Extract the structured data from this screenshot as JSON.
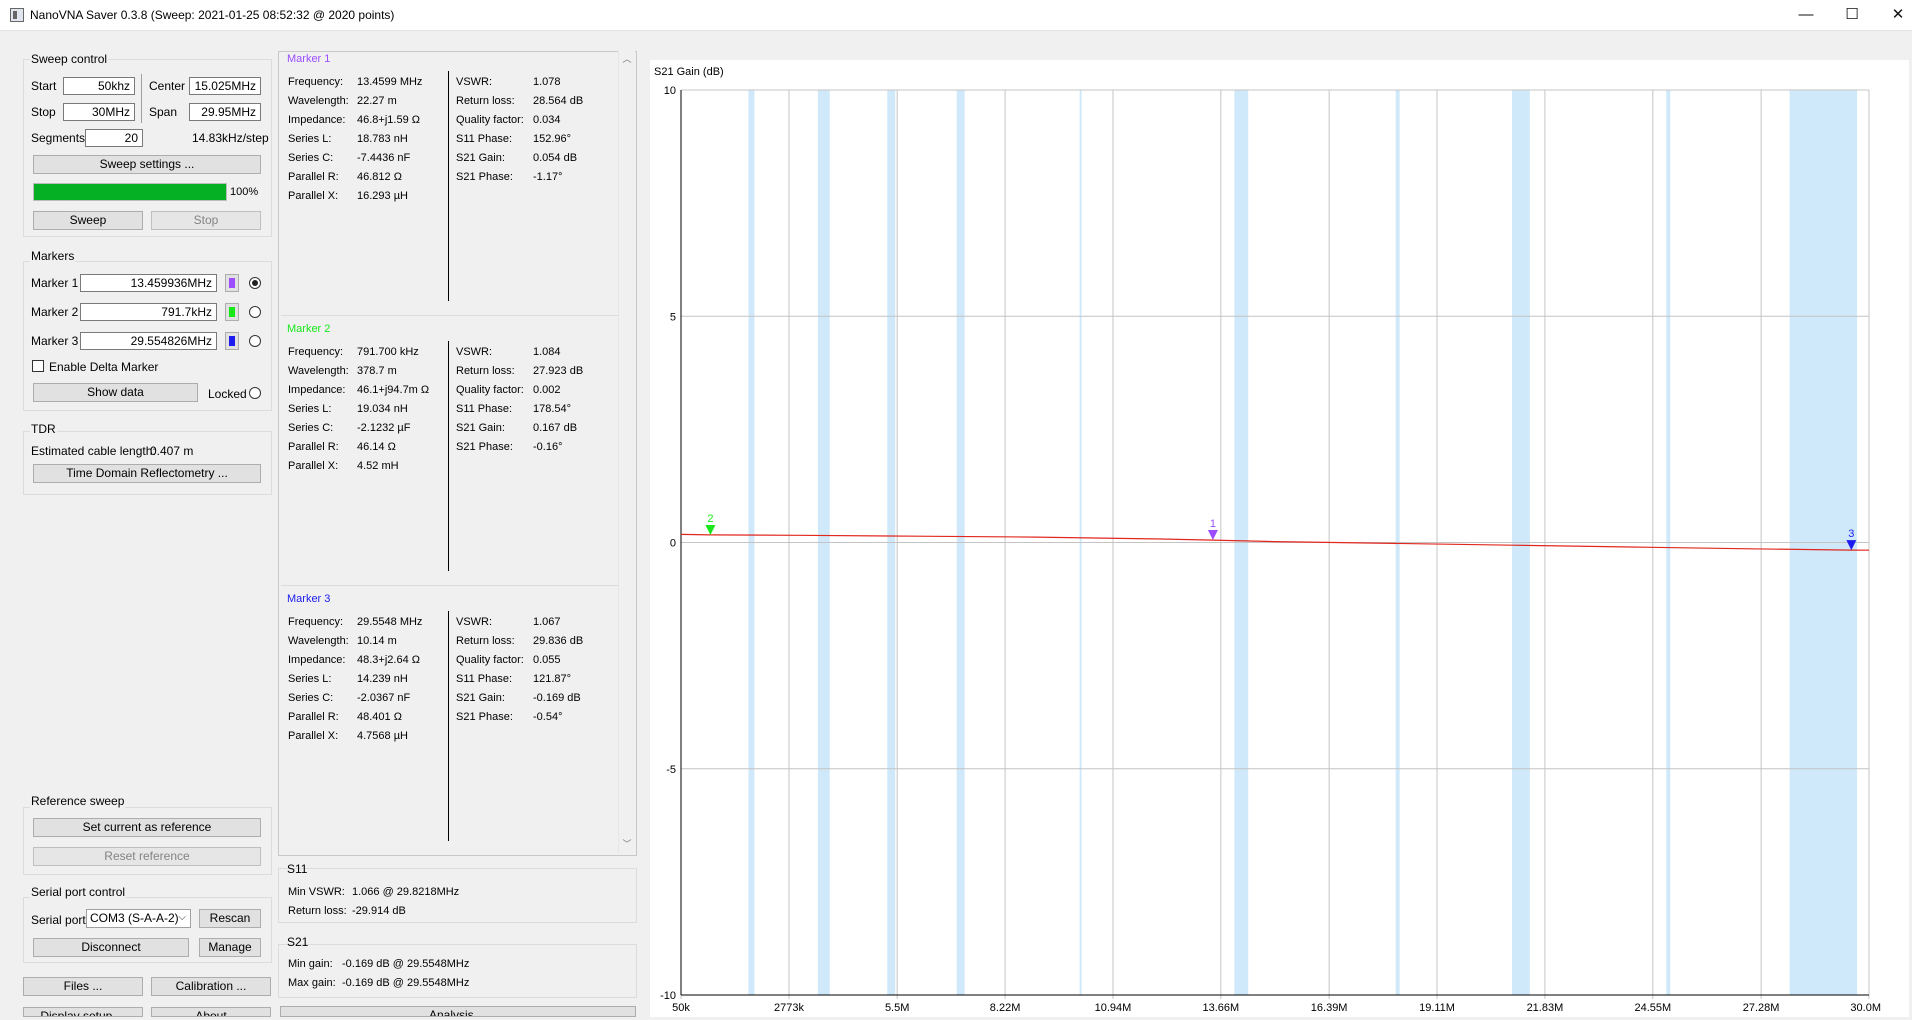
{
  "window": {
    "title": "NanoVNA Saver 0.3.8 (Sweep: 2021-01-25 08:52:32 @ 2020 points)",
    "minimize": "—",
    "maximize": "☐",
    "close": "✕"
  },
  "sweep_control": {
    "title": "Sweep control",
    "start_label": "Start",
    "start_value": "50khz",
    "center_label": "Center",
    "center_value": "15.025MHz",
    "stop_label": "Stop",
    "stop_value": "30MHz",
    "span_label": "Span",
    "span_value": "29.95MHz",
    "segments_label": "Segments",
    "segments_value": "20",
    "step_text": "14.83kHz/step",
    "settings_button": "Sweep settings ...",
    "progress": 100,
    "progress_text": "100%",
    "sweep_button": "Sweep",
    "stop_button": "Stop"
  },
  "markers": {
    "title": "Markers",
    "items": [
      {
        "label": "Marker 1",
        "value": "13.459936MHz",
        "color": "#9b4dff",
        "selected": true
      },
      {
        "label": "Marker 2",
        "value": "791.7kHz",
        "color": "#18e81a",
        "selected": false
      },
      {
        "label": "Marker 3",
        "value": "29.554826MHz",
        "color": "#1c1cf0",
        "selected": false
      }
    ],
    "delta_label": "Enable Delta Marker",
    "show_data_button": "Show data",
    "locked_label": "Locked"
  },
  "tdr": {
    "title": "TDR",
    "cable_label": "Estimated cable length:",
    "cable_value": "0.407 m",
    "button": "Time Domain Reflectometry ..."
  },
  "reference": {
    "title": "Reference sweep",
    "set_button": "Set current as reference",
    "reset_button": "Reset reference"
  },
  "serial": {
    "title": "Serial port control",
    "port_label": "Serial port",
    "port_value": "COM3 (S-A-A-2)",
    "rescan_button": "Rescan",
    "disconnect_button": "Disconnect",
    "manage_button": "Manage"
  },
  "bottom_buttons": {
    "files": "Files ...",
    "calibration": "Calibration ...",
    "display": "Display setup ...",
    "about": "About",
    "analysis": "Analysis ..."
  },
  "marker_details": [
    {
      "title": "Marker 1",
      "color": "#9b4dff",
      "left": [
        {
          "k": "Frequency:",
          "v": "13.4599 MHz"
        },
        {
          "k": "Wavelength:",
          "v": "22.27 m"
        },
        {
          "k": "Impedance:",
          "v": "46.8+j1.59 Ω"
        },
        {
          "k": "Series L:",
          "v": "18.783 nH"
        },
        {
          "k": "Series C:",
          "v": "-7.4436 nF"
        },
        {
          "k": "Parallel R:",
          "v": "46.812 Ω"
        },
        {
          "k": "Parallel X:",
          "v": "16.293 µH"
        }
      ],
      "right": [
        {
          "k": "VSWR:",
          "v": "1.078"
        },
        {
          "k": "Return loss:",
          "v": "28.564 dB"
        },
        {
          "k": "Quality factor:",
          "v": "0.034"
        },
        {
          "k": "S11 Phase:",
          "v": "152.96°"
        },
        {
          "k": "S21 Gain:",
          "v": "0.054 dB"
        },
        {
          "k": "S21 Phase:",
          "v": "-1.17°"
        }
      ]
    },
    {
      "title": "Marker 2",
      "color": "#18e81a",
      "left": [
        {
          "k": "Frequency:",
          "v": "791.700 kHz"
        },
        {
          "k": "Wavelength:",
          "v": "378.7 m"
        },
        {
          "k": "Impedance:",
          "v": "46.1+j94.7m Ω"
        },
        {
          "k": "Series L:",
          "v": "19.034 nH"
        },
        {
          "k": "Series C:",
          "v": "-2.1232 µF"
        },
        {
          "k": "Parallel R:",
          "v": "46.14 Ω"
        },
        {
          "k": "Parallel X:",
          "v": "4.52 mH"
        }
      ],
      "right": [
        {
          "k": "VSWR:",
          "v": "1.084"
        },
        {
          "k": "Return loss:",
          "v": "27.923 dB"
        },
        {
          "k": "Quality factor:",
          "v": "0.002"
        },
        {
          "k": "S11 Phase:",
          "v": "178.54°"
        },
        {
          "k": "S21 Gain:",
          "v": "0.167 dB"
        },
        {
          "k": "S21 Phase:",
          "v": "-0.16°"
        }
      ]
    },
    {
      "title": "Marker 3",
      "color": "#1c1cf0",
      "left": [
        {
          "k": "Frequency:",
          "v": "29.5548 MHz"
        },
        {
          "k": "Wavelength:",
          "v": "10.14 m"
        },
        {
          "k": "Impedance:",
          "v": "48.3+j2.64 Ω"
        },
        {
          "k": "Series L:",
          "v": "14.239 nH"
        },
        {
          "k": "Series C:",
          "v": "-2.0367 nF"
        },
        {
          "k": "Parallel R:",
          "v": "48.401 Ω"
        },
        {
          "k": "Parallel X:",
          "v": "4.7568 µH"
        }
      ],
      "right": [
        {
          "k": "VSWR:",
          "v": "1.067"
        },
        {
          "k": "Return loss:",
          "v": "29.836 dB"
        },
        {
          "k": "Quality factor:",
          "v": "0.055"
        },
        {
          "k": "S11 Phase:",
          "v": "121.87°"
        },
        {
          "k": "S21 Gain:",
          "v": "-0.169 dB"
        },
        {
          "k": "S21 Phase:",
          "v": "-0.54°"
        }
      ]
    }
  ],
  "s11_summary": {
    "title": "S11",
    "min_vswr_label": "Min VSWR:",
    "min_vswr_value": "1.066 @ 29.8218MHz",
    "return_loss_label": "Return loss:",
    "return_loss_value": "-29.914 dB"
  },
  "s21_summary": {
    "title": "S21",
    "min_gain_label": "Min gain:",
    "min_gain_value": "-0.169 dB @ 29.5548MHz",
    "max_gain_label": "Max gain:",
    "max_gain_value": "-0.169 dB @ 29.5548MHz"
  },
  "chart_data": {
    "type": "line",
    "title": "S21 Gain (dB)",
    "xlim": [
      0.05,
      30.0
    ],
    "ylim": [
      -10,
      10
    ],
    "x_ticks": [
      {
        "v": 0.05,
        "label": "50k"
      },
      {
        "v": 2.773,
        "label": "2773k"
      },
      {
        "v": 5.5,
        "label": "5.5M"
      },
      {
        "v": 8.22,
        "label": "8.22M"
      },
      {
        "v": 10.94,
        "label": "10.94M"
      },
      {
        "v": 13.66,
        "label": "13.66M"
      },
      {
        "v": 16.39,
        "label": "16.39M"
      },
      {
        "v": 19.11,
        "label": "19.11M"
      },
      {
        "v": 21.83,
        "label": "21.83M"
      },
      {
        "v": 24.55,
        "label": "24.55M"
      },
      {
        "v": 27.28,
        "label": "27.28M"
      },
      {
        "v": 30.0,
        "label": "30.0M"
      }
    ],
    "y_ticks": [
      {
        "v": 10,
        "label": "10"
      },
      {
        "v": 5,
        "label": "5"
      },
      {
        "v": 0,
        "label": "0"
      },
      {
        "v": -5,
        "label": "-5"
      },
      {
        "v": -10,
        "label": "-10"
      }
    ],
    "band_color": "#cfe9fa",
    "trace_color": "#e0281e",
    "bands": [
      [
        1.75,
        1.9
      ],
      [
        3.5,
        3.8
      ],
      [
        5.25,
        5.45
      ],
      [
        7.0,
        7.2
      ],
      [
        10.1,
        10.15
      ],
      [
        14.0,
        14.35
      ],
      [
        18.068,
        18.168
      ],
      [
        21.0,
        21.45
      ],
      [
        24.89,
        24.99
      ],
      [
        28.0,
        29.7
      ]
    ],
    "series": [
      {
        "x": [
          0.05,
          0.8,
          3.0,
          6.0,
          9.0,
          12.0,
          13.46,
          15.0,
          18.0,
          21.0,
          24.0,
          27.0,
          29.55,
          30.0
        ],
        "values": [
          0.18,
          0.167,
          0.16,
          0.14,
          0.12,
          0.08,
          0.054,
          0.02,
          -0.02,
          -0.06,
          -0.1,
          -0.14,
          -0.169,
          -0.17
        ]
      }
    ],
    "markers": [
      {
        "label": "2",
        "x": 0.7917,
        "y": 0.167,
        "color": "#18e81a"
      },
      {
        "label": "1",
        "x": 13.4599,
        "y": 0.054,
        "color": "#9b4dff"
      },
      {
        "label": "3",
        "x": 29.5548,
        "y": -0.169,
        "color": "#1c1cf0"
      }
    ]
  }
}
